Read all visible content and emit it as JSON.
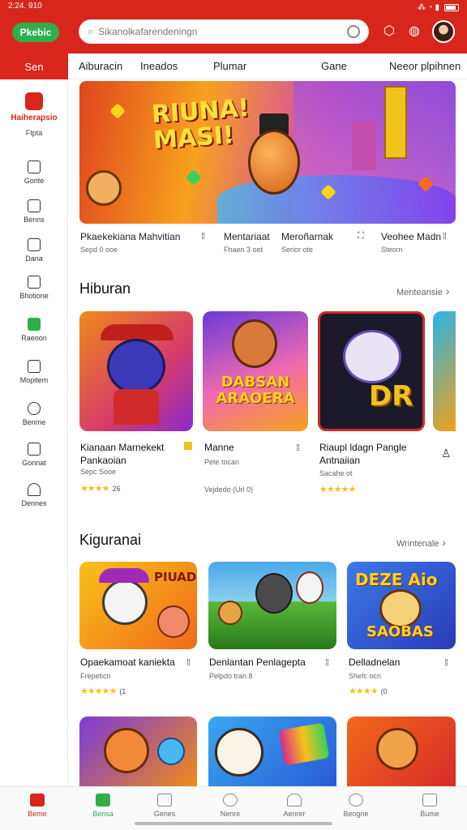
{
  "status": {
    "time": "2:24. 910",
    "icons": "⁂ ◔ ▮"
  },
  "header": {
    "logo": "Pkebic",
    "search_placeholder": "Sikanolkafarendeningn",
    "search_icon": "search-icon",
    "notif_icon": "bell-icon",
    "profile_icon": "person-icon"
  },
  "tabs": {
    "selected": "Sen",
    "items": [
      "Aiburacin",
      "Ineados",
      "Plumar",
      "Gane",
      "Neeor plpihnen"
    ]
  },
  "sidebar": {
    "active_label": "Haiherapsio",
    "active_sub": "Ftpta",
    "items": [
      "Gonte",
      "Benns",
      "Dana",
      "Bhotione",
      "Raeoon",
      "Mopitem",
      "Benme",
      "Gonnat",
      "Dennes"
    ]
  },
  "banner": {
    "title_line1": "RIUNA!",
    "title_line2": "MASI!"
  },
  "featured": [
    {
      "title": "Pkaekekiana Mahvitian",
      "sub": "Sepd 0 ooe"
    },
    {
      "title": "Mentariaat",
      "sub": "Fhaen 3 oet"
    },
    {
      "title": "Meroñarnak",
      "sub": "Serior ote"
    },
    {
      "title": "Veohee Madn",
      "sub": "Steorn"
    }
  ],
  "section1": {
    "title": "Hiburan",
    "more": "Menteansie",
    "cards": [
      {
        "title": "Kianaan Marnekekt Pankaoian",
        "sub": "Sepc Sooe",
        "stars": "★★★★",
        "rating": "26"
      },
      {
        "title": "Manne",
        "sub": "Pete tocan",
        "extra": "Vejdedo (Url 0)"
      },
      {
        "title": "Riaupl ldagn Pangle Antnaiian",
        "sub": "Sacahe ot",
        "stars": "★★★★★",
        "rating": ""
      }
    ],
    "art_text": [
      "DABSAN",
      "ARAOERA",
      "DR"
    ]
  },
  "section2": {
    "title": "Kiguranai",
    "more": "Wrintenale",
    "cards": [
      {
        "title": "Opaekamoat kaniekta",
        "sub": "Frepeticn",
        "stars": "★★★★★",
        "rating": "(1"
      },
      {
        "title": "Denlantan Penlagepta",
        "sub": "Pelpdo tran 8",
        "stars": "",
        "rating": ""
      },
      {
        "title": "Delladnelan",
        "sub": "Shefc ocn",
        "stars": "★★★★",
        "rating": "(0"
      }
    ],
    "art_text": [
      "PIUAD",
      "DEZE Aio",
      "SAOBAS"
    ]
  },
  "bottom_nav": [
    "Beme",
    "Bensa",
    "Genes",
    "Nenre",
    "Aenrer",
    "Beogne",
    "Bume"
  ],
  "colors": {
    "brand_red": "#d8261c",
    "logo_green": "#2fae4a",
    "star": "#f2c21a"
  }
}
